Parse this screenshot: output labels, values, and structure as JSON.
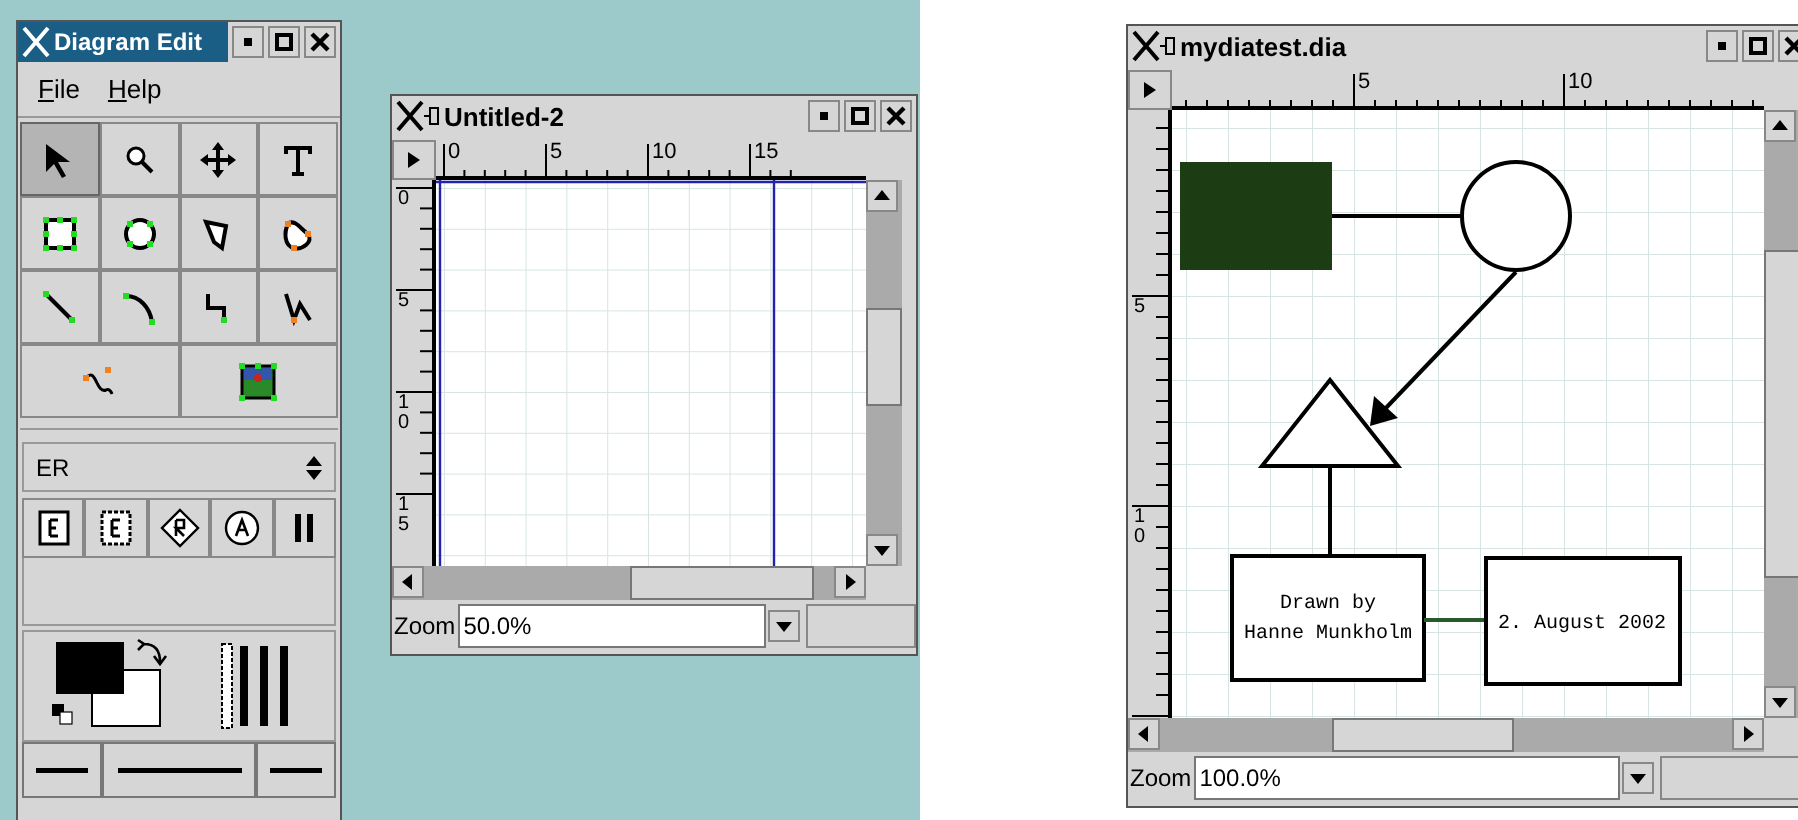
{
  "toolbox": {
    "title": "Diagram Edit",
    "active": true,
    "menu": [
      {
        "label": "File"
      },
      {
        "label": "Help"
      }
    ],
    "tools": [
      {
        "kind": "pointer",
        "selected": true
      },
      {
        "kind": "magnify",
        "selected": false
      },
      {
        "kind": "move",
        "selected": false
      },
      {
        "kind": "text",
        "selected": false
      },
      {
        "kind": "box",
        "selected": false
      },
      {
        "kind": "ellipse",
        "selected": false
      },
      {
        "kind": "polygon",
        "selected": false
      },
      {
        "kind": "beziergon",
        "selected": false
      },
      {
        "kind": "line",
        "selected": false
      },
      {
        "kind": "arc",
        "selected": false
      },
      {
        "kind": "zigzag",
        "selected": false
      },
      {
        "kind": "polyline",
        "selected": false
      },
      {
        "kind": "bezier",
        "selected": false
      },
      {
        "kind": "image",
        "selected": false
      }
    ],
    "sheet": {
      "value": "ER"
    },
    "sheet_tools": [
      {
        "kind": "entity"
      },
      {
        "kind": "weak-entity"
      },
      {
        "kind": "relationship"
      },
      {
        "kind": "attribute"
      },
      {
        "kind": "participation"
      }
    ]
  },
  "windows": [
    {
      "title": "Untitled-2",
      "active": false,
      "top_ruler": [
        "0",
        "5",
        "10",
        "15"
      ],
      "left_ruler": [
        "0",
        "5",
        "10",
        "15"
      ],
      "zoom_label": "Zoom",
      "zoom_value": "50.0%"
    },
    {
      "title": "mydiatest.dia",
      "active": false,
      "top_ruler": [
        "5",
        "10"
      ],
      "left_ruler": [
        "5",
        "10"
      ],
      "zoom_label": "Zoom",
      "zoom_value": "100.0%",
      "diagram": {
        "box_1_lines": [
          "Drawn by",
          "Hanne Munkholm"
        ],
        "box_2_text": "2. August 2002"
      }
    }
  ]
}
